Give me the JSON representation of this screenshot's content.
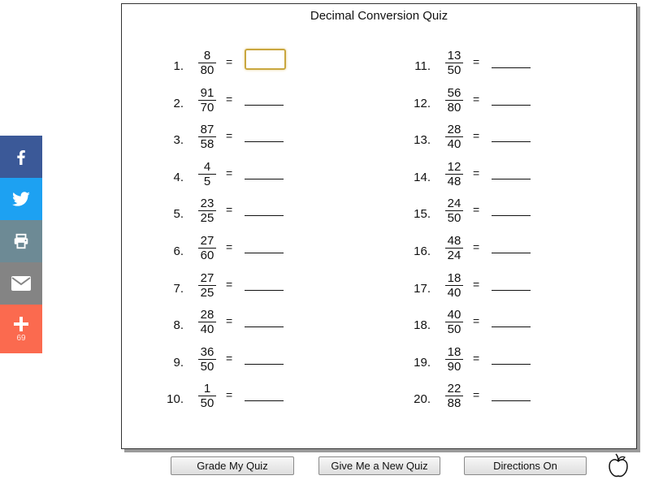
{
  "share": {
    "facebook_icon": "facebook-icon",
    "twitter_icon": "twitter-icon",
    "print_icon": "printer-icon",
    "email_icon": "envelope-icon",
    "more_icon": "plus-icon",
    "more_count": "69",
    "colors": {
      "facebook": "#3b5998",
      "twitter": "#1da1f2",
      "print": "#6d8a95",
      "email": "#848484",
      "more": "#fb6a4f"
    }
  },
  "quiz": {
    "title": "Decimal Conversion Quiz",
    "equals": "=",
    "problems": [
      {
        "number": "1.",
        "numerator": "8",
        "denominator": "80",
        "answer": ""
      },
      {
        "number": "2.",
        "numerator": "91",
        "denominator": "70",
        "answer": ""
      },
      {
        "number": "3.",
        "numerator": "87",
        "denominator": "58",
        "answer": ""
      },
      {
        "number": "4.",
        "numerator": "4",
        "denominator": "5",
        "answer": ""
      },
      {
        "number": "5.",
        "numerator": "23",
        "denominator": "25",
        "answer": ""
      },
      {
        "number": "6.",
        "numerator": "27",
        "denominator": "60",
        "answer": ""
      },
      {
        "number": "7.",
        "numerator": "27",
        "denominator": "25",
        "answer": ""
      },
      {
        "number": "8.",
        "numerator": "28",
        "denominator": "40",
        "answer": ""
      },
      {
        "number": "9.",
        "numerator": "36",
        "denominator": "50",
        "answer": ""
      },
      {
        "number": "10.",
        "numerator": "1",
        "denominator": "50",
        "answer": ""
      },
      {
        "number": "11.",
        "numerator": "13",
        "denominator": "50",
        "answer": ""
      },
      {
        "number": "12.",
        "numerator": "56",
        "denominator": "80",
        "answer": ""
      },
      {
        "number": "13.",
        "numerator": "28",
        "denominator": "40",
        "answer": ""
      },
      {
        "number": "14.",
        "numerator": "12",
        "denominator": "48",
        "answer": ""
      },
      {
        "number": "15.",
        "numerator": "24",
        "denominator": "50",
        "answer": ""
      },
      {
        "number": "16.",
        "numerator": "48",
        "denominator": "24",
        "answer": ""
      },
      {
        "number": "17.",
        "numerator": "18",
        "denominator": "40",
        "answer": ""
      },
      {
        "number": "18.",
        "numerator": "40",
        "denominator": "50",
        "answer": ""
      },
      {
        "number": "19.",
        "numerator": "18",
        "denominator": "90",
        "answer": ""
      },
      {
        "number": "20.",
        "numerator": "22",
        "denominator": "88",
        "answer": ""
      }
    ]
  },
  "buttons": {
    "grade": "Grade My Quiz",
    "new_quiz": "Give Me a New Quiz",
    "directions": "Directions On"
  },
  "logo_icon": "apple-icon",
  "focus_color": "#c9a73f"
}
